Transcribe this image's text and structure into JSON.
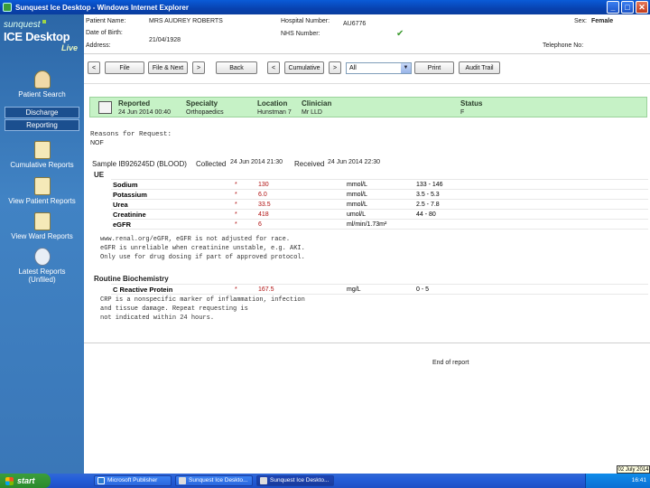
{
  "window": {
    "title": "Sunquest Ice Desktop - Windows Internet Explorer",
    "min": "_",
    "max": "□",
    "close": "✕"
  },
  "brand": {
    "line1": "sunquest",
    "line2": "ICE Desktop",
    "line3": "Live"
  },
  "sidebar": {
    "patient_search": "Patient Search",
    "discharge": "Discharge",
    "reporting": "Reporting",
    "cumulative_reports": "Cumulative Reports",
    "view_patient_reports": "View Patient Reports",
    "view_ward_reports": "View Ward Reports",
    "latest_reports_1": "Latest Reports",
    "latest_reports_2": "(Unfiled)"
  },
  "header": {
    "patient_name_label": "Patient Name:",
    "patient_name": "MRS AUDREY ROBERTS",
    "dob_label": "Date of Birth:",
    "dob": "21/04/1928",
    "address_label": "Address:",
    "hospital_number_label": "Hospital Number:",
    "hospital_number": "AU6776",
    "nhs_label": "NHS Number:",
    "nhs_check": "✔",
    "sex_label": "Sex:",
    "sex": "Female",
    "telephone_label": "Telephone No:"
  },
  "toolbar": {
    "prev": "<",
    "file": "File",
    "file_next": "File & Next",
    "next": ">",
    "back": "Back",
    "prev2": "<",
    "cumulative": "Cumulative",
    "next2": ">",
    "filter_value": "All",
    "filter_arrow": "▼",
    "print": "Print",
    "audit_trail": "Audit Trail"
  },
  "report": {
    "headers": {
      "reported": "Reported",
      "specialty": "Specialty",
      "location": "Location",
      "clinician": "Clinician",
      "status": "Status"
    },
    "values": {
      "reported": "24 Jun 2014 00:40",
      "specialty": "Orthopaedics",
      "location": "Hunstman 7",
      "clinician": "Mr LLD",
      "status": "F"
    },
    "reasons_label": "Reasons for Request:",
    "reasons": "NOF",
    "sample_label": "Sample IB926245D (BLOOD)",
    "collected_label": "Collected",
    "collected": "24 Jun 2014 21:30",
    "received_label": "Received",
    "received": "24 Jun 2014 22:30",
    "ue_title": "UE",
    "ue_rows": [
      {
        "name": "Sodium",
        "flag": "*",
        "value": "130",
        "unit": "mmol/L",
        "range": "133 - 146"
      },
      {
        "name": "Potassium",
        "flag": "*",
        "value": "6.0",
        "unit": "mmol/L",
        "range": "3.5 - 5.3"
      },
      {
        "name": "Urea",
        "flag": "*",
        "value": "33.5",
        "unit": "mmol/L",
        "range": "2.5 - 7.8"
      },
      {
        "name": "Creatinine",
        "flag": "*",
        "value": "418",
        "unit": "umol/L",
        "range": "44 - 80"
      },
      {
        "name": "eGFR",
        "flag": "*",
        "value": "6",
        "unit": "ml/min/1.73m²",
        "range": ""
      }
    ],
    "egfr_note": "www.renal.org/eGFR, eGFR is not adjusted for race.\neGFR is unreliable when creatinine unstable, e.g. AKI.\nOnly use for drug dosing if part of approved protocol.",
    "routine_title": "Routine Biochemistry",
    "crp": {
      "name": "C Reactive Protein",
      "flag": "*",
      "value": "167.5",
      "unit": "mg/L",
      "range": "0 - 5"
    },
    "crp_note": "CRP is a nonspecific marker of inflammation, infection\nand tissue damage. Repeat requesting is\nnot indicated within 24 hours.",
    "end": "End of report"
  },
  "taskbar": {
    "start": "start",
    "tasks": [
      "Microsoft Publisher",
      "Sunquest Ice Deskto...",
      "Sunquest Ice Deskto..."
    ],
    "clock": "16:41",
    "tooltip": "02 July 2014"
  }
}
